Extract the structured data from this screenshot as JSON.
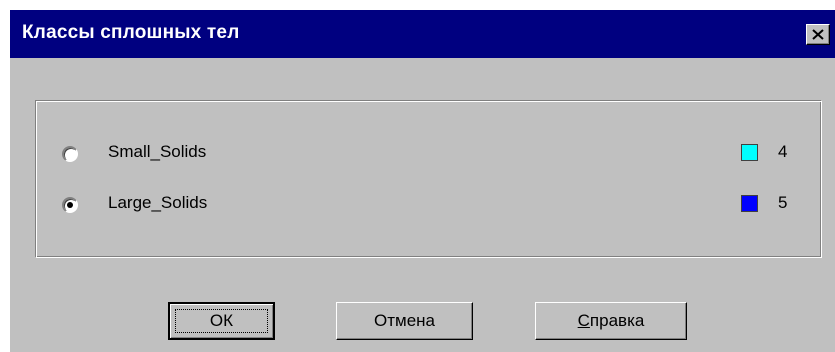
{
  "window": {
    "title": "Классы сплошных тел"
  },
  "classes": [
    {
      "label": "Small_Solids",
      "selected": false,
      "color": "#00ffff",
      "value": "4"
    },
    {
      "label": "Large_Solids",
      "selected": true,
      "color": "#0000ff",
      "value": "5"
    }
  ],
  "buttons": {
    "ok": "ОК",
    "cancel": "Отмена",
    "help_first": "С",
    "help_rest": "правка"
  },
  "icons": {
    "close": "close-icon"
  }
}
